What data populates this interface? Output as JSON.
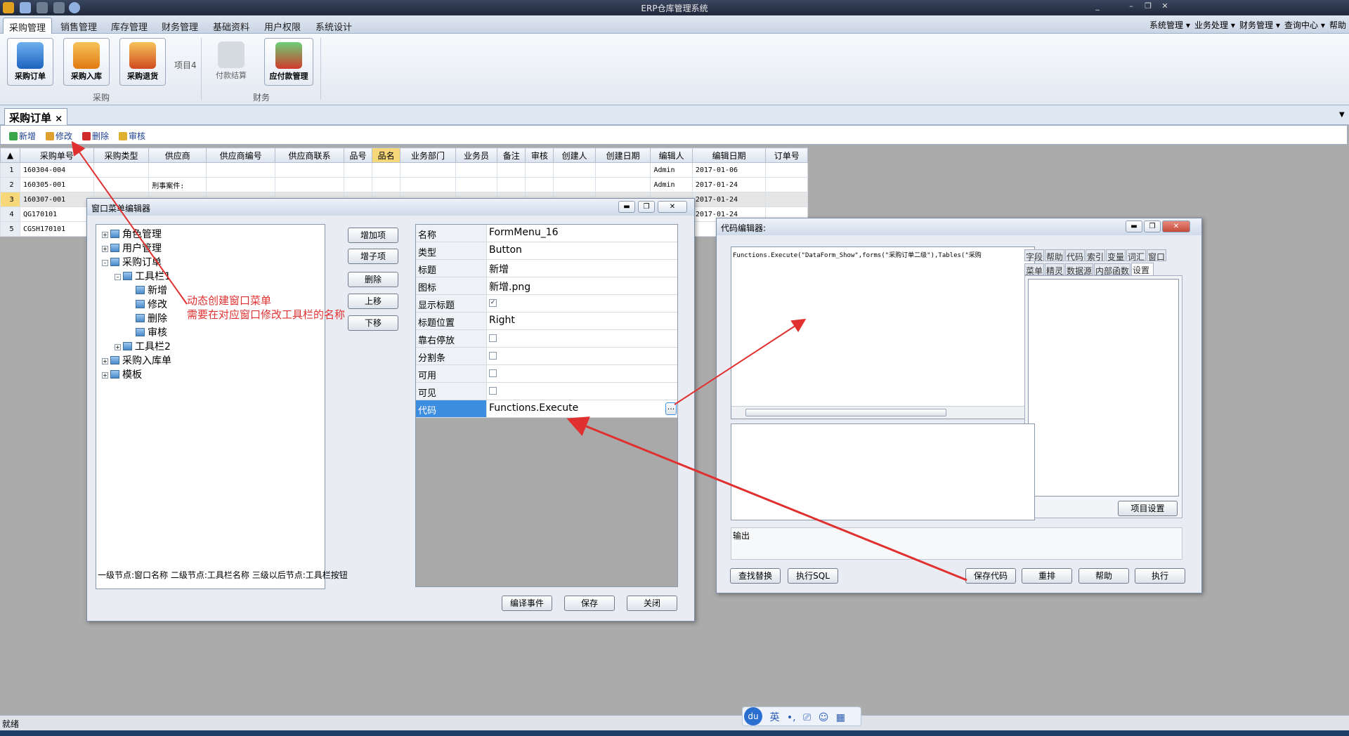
{
  "app": {
    "title": "ERP仓库管理系统"
  },
  "menu": {
    "tabs": [
      "采购管理",
      "销售管理",
      "库存管理",
      "财务管理",
      "基础资料",
      "用户权限",
      "系统设计"
    ],
    "right": [
      "系统管理 ▾",
      "业务处理 ▾",
      "财务管理 ▾",
      "查询中心 ▾",
      "帮助"
    ]
  },
  "ribbon": {
    "buttons": [
      "采购订单",
      "采购入库",
      "采购退货",
      "付款结算",
      "应付款管理"
    ],
    "item4": "项目4",
    "groups": [
      "采购",
      "财务"
    ]
  },
  "doc": {
    "tab_label": "采购订单",
    "close": "×"
  },
  "toolbar": {
    "add": "新增",
    "edit": "修改",
    "delete": "删除",
    "audit": "审核"
  },
  "grid": {
    "corner": "▲",
    "columns": [
      "采购单号",
      "采购类型",
      "供应商",
      "供应商编号",
      "供应商联系",
      "品号",
      "品名",
      "业务部门",
      "业务员",
      "备注",
      "审核",
      "创建人",
      "创建日期",
      "编辑人",
      "编辑日期",
      "订单号"
    ],
    "rows": [
      {
        "n": "1",
        "no": "160304-004",
        "supplier": "",
        "editor": "Admin",
        "date": "2017-01-06"
      },
      {
        "n": "2",
        "no": "160305-001",
        "supplier": "刑事案件:",
        "editor": "Admin",
        "date": "2017-01-24"
      },
      {
        "n": "3",
        "no": "160307-001",
        "supplier": "",
        "editor": "",
        "date": "2017-01-24"
      },
      {
        "n": "4",
        "no": "QG170101",
        "supplier": "",
        "editor": "",
        "date": "2017-01-24"
      },
      {
        "n": "5",
        "no": "CGSH170101",
        "supplier": "",
        "editor": "",
        "date": ""
      }
    ]
  },
  "menu_editor": {
    "title": "窗口菜单编辑器",
    "tree": [
      "角色管理",
      "用户管理",
      "采购订单",
      "工具栏1",
      "新增",
      "修改",
      "删除",
      "审核",
      "工具栏2",
      "采购入库单",
      "模板"
    ],
    "tree_hint": "一级节点:窗口名称 二级节点:工具栏名称 三级以后节点:工具栏按钮",
    "buttons": [
      "增加项",
      "增子项",
      "删除",
      "上移",
      "下移"
    ],
    "props": [
      {
        "k": "名称",
        "v": "FormMenu_16"
      },
      {
        "k": "类型",
        "v": "Button"
      },
      {
        "k": "标题",
        "v": "新增"
      },
      {
        "k": "图标",
        "v": "新增.png"
      },
      {
        "k": "显示标题",
        "v": "✓"
      },
      {
        "k": "标题位置",
        "v": "Right"
      },
      {
        "k": "靠右停放",
        "v": ""
      },
      {
        "k": "分割条",
        "v": ""
      },
      {
        "k": "可用",
        "v": ""
      },
      {
        "k": "可见",
        "v": ""
      },
      {
        "k": "代码",
        "v": "Functions.Execute"
      }
    ],
    "ellipsis": "...",
    "footer": [
      "编译事件",
      "保存",
      "关闭"
    ]
  },
  "annotation": {
    "line1": "动态创建窗口菜单",
    "line2": "需要在对应窗口修改工具栏的名称",
    "color": "#e03030"
  },
  "code_editor": {
    "title": "代码编辑器:",
    "code": "Functions.Execute(\"DataForm_Show\",forms(\"采购订单二级\"),Tables(\"采购",
    "tabs_row1": [
      "字段",
      "帮助",
      "代码",
      "索引",
      "变量",
      "词汇",
      "窗口"
    ],
    "tabs_row2": [
      "菜单",
      "精灵",
      "数据源",
      "内部函数",
      "设置"
    ],
    "item_settings": "项目设置",
    "output_label": "输出",
    "buttons_left": [
      "查找替换",
      "执行SQL"
    ],
    "buttons_right": [
      "保存代码",
      "重排",
      "帮助",
      "执行"
    ]
  },
  "status": {
    "text": "就绪"
  },
  "ime": {
    "logo": "du",
    "items": [
      "英",
      "•,",
      "⎚",
      "☺",
      "▦"
    ]
  }
}
